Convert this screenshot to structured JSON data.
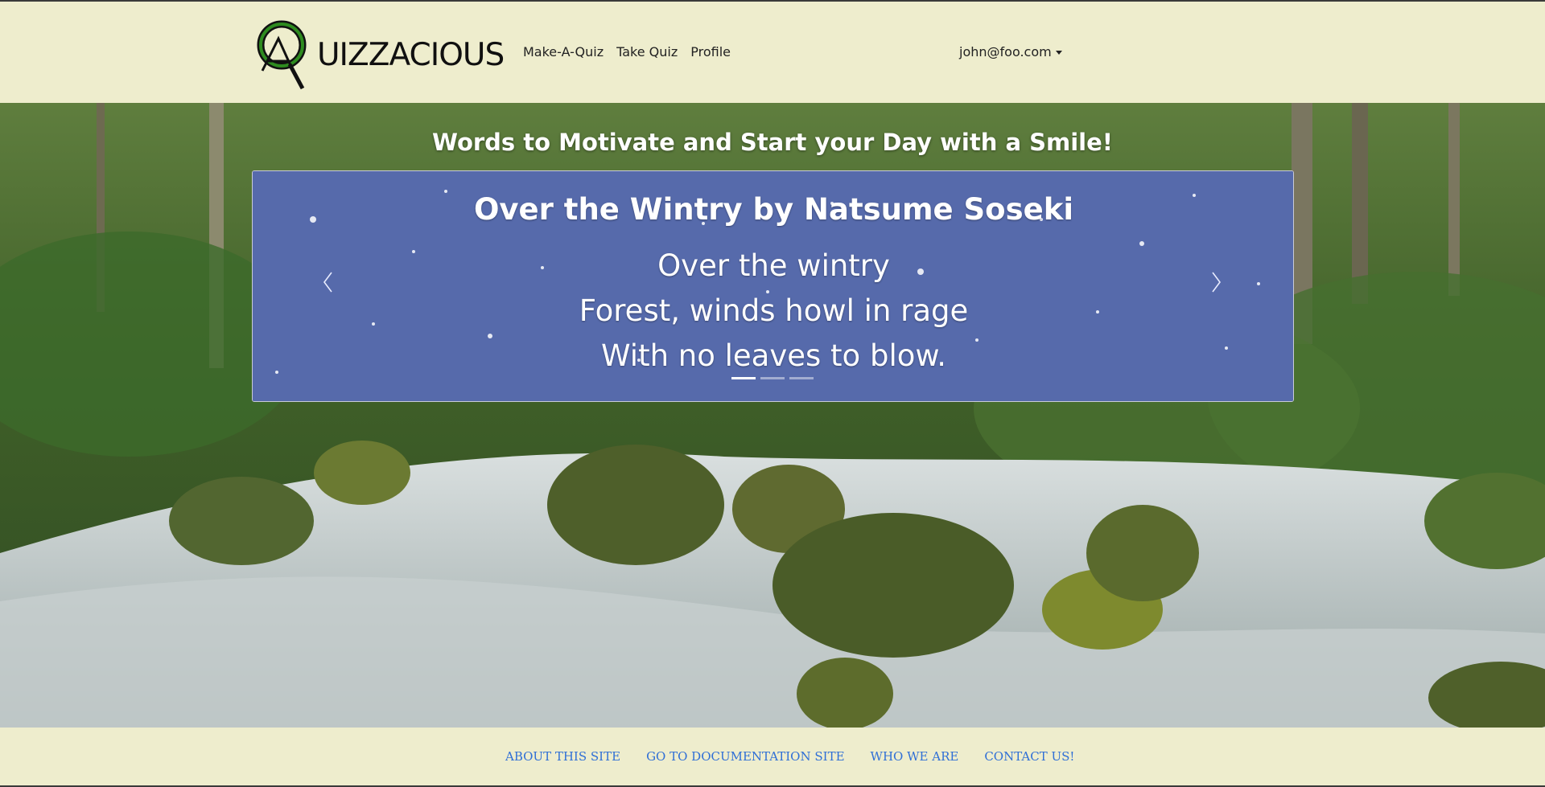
{
  "navbar": {
    "brand_text": "UIZZACIOUS",
    "links": [
      {
        "label": "Make-A-Quiz"
      },
      {
        "label": "Take Quiz"
      },
      {
        "label": "Profile"
      }
    ],
    "user_email": "john@foo.com"
  },
  "hero": {
    "heading": "Words to Motivate and Start your Day with a Smile!"
  },
  "carousel": {
    "title": "Over the Wintry by Natsume Soseki",
    "lines": [
      "Over the wintry",
      "Forest, winds howl in rage",
      "With no leaves to blow."
    ],
    "slide_count": 3,
    "active_index": 0,
    "prev_icon": "chevron-left-icon",
    "next_icon": "chevron-right-icon"
  },
  "footer": {
    "links": [
      {
        "label": "ABOUT THIS SITE"
      },
      {
        "label": "GO TO DOCUMENTATION SITE"
      },
      {
        "label": "WHO WE ARE"
      },
      {
        "label": "CONTACT US!"
      }
    ]
  },
  "colors": {
    "page_bg": "#eeedcd",
    "link_blue": "#2f6fd6",
    "carousel_blue": "#4f63a4",
    "logo_green": "#2e8b1f"
  }
}
